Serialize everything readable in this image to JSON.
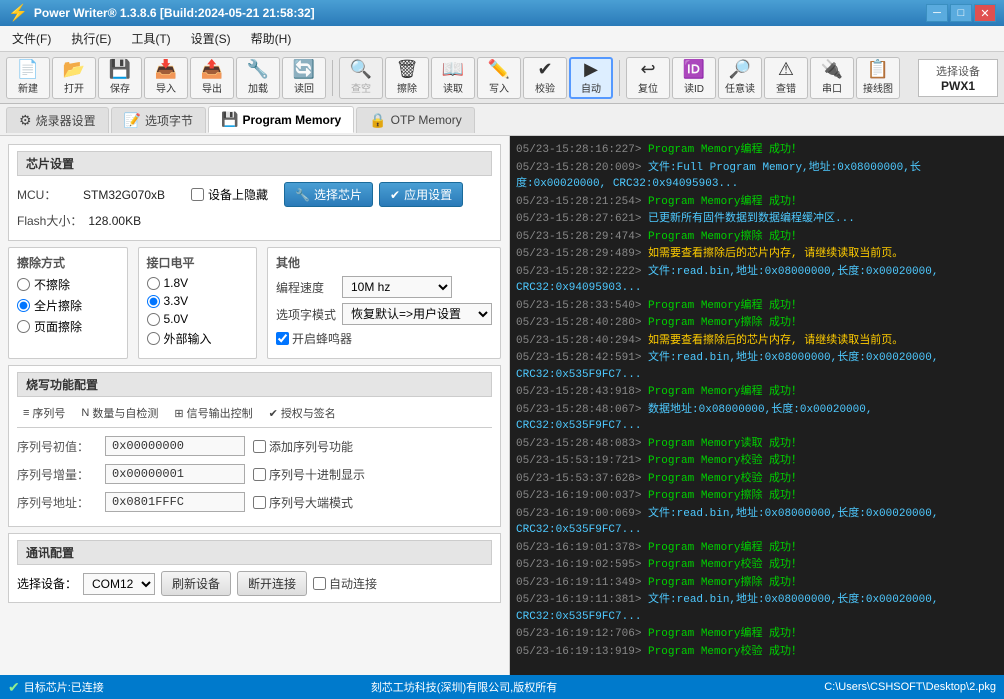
{
  "titlebar": {
    "title": "Power Writer® 1.3.8.6 [Build:2024-05-21 21:58:32]",
    "min": "─",
    "max": "□",
    "close": "✕"
  },
  "menubar": {
    "items": [
      "文件(F)",
      "执行(E)",
      "工具(T)",
      "设置(S)",
      "帮助(H)"
    ]
  },
  "toolbar": {
    "buttons": [
      {
        "label": "新建",
        "icon": "📄"
      },
      {
        "label": "打开",
        "icon": "📂"
      },
      {
        "label": "保存",
        "icon": "💾"
      },
      {
        "label": "导入",
        "icon": "📥"
      },
      {
        "label": "导出",
        "icon": "📤"
      },
      {
        "label": "加载",
        "icon": "🔧"
      },
      {
        "label": "读回",
        "icon": "🔄"
      },
      {
        "label": "查空",
        "icon": "🔍",
        "disabled": true
      },
      {
        "label": "擦除",
        "icon": "🗑"
      },
      {
        "label": "读取",
        "icon": "📖"
      },
      {
        "label": "写入",
        "icon": "✏️"
      },
      {
        "label": "校验",
        "icon": "✔"
      },
      {
        "label": "自动",
        "icon": "▶"
      },
      {
        "label": "复位",
        "icon": "↩"
      },
      {
        "label": "读ID",
        "icon": "🆔"
      },
      {
        "label": "任意读",
        "icon": "🔎"
      },
      {
        "label": "查错",
        "icon": "⚠"
      },
      {
        "label": "串口",
        "icon": "🔌"
      },
      {
        "label": "接线图",
        "icon": "📋"
      }
    ],
    "device_label": "选择设备",
    "device_value": "PWX1"
  },
  "tabs": [
    {
      "label": "烧录器设置",
      "icon": "⚙",
      "active": false
    },
    {
      "label": "选项字节",
      "icon": "📝",
      "active": false
    },
    {
      "label": "Program Memory",
      "icon": "💾",
      "active": true
    },
    {
      "label": "OTP Memory",
      "icon": "🔒",
      "active": false
    }
  ],
  "chip_settings": {
    "title": "芯片设置",
    "mcu_label": "MCU：",
    "mcu_value": "STM32G070xB",
    "hidden_label": "设备上隐藏",
    "flash_label": "Flash大小：",
    "flash_value": "128.00KB",
    "select_chip_btn": "选择芯片",
    "apply_btn": "应用设置"
  },
  "erase": {
    "title": "擦除方式",
    "options": [
      "不擦除",
      "全片擦除",
      "页面擦除"
    ],
    "selected": 1
  },
  "interface": {
    "title": "接口电平",
    "options": [
      "1.8V",
      "3.3V",
      "5.0V",
      "外部输入"
    ],
    "selected": 1
  },
  "other": {
    "title": "其他",
    "speed_label": "编程速度",
    "speed_value": "10M hz",
    "mode_label": "选项字模式",
    "mode_value": "恢复默认=>用户设置",
    "buzzer_label": "开启蜂鸣器",
    "buzzer_checked": true
  },
  "write_config": {
    "title": "烧写功能配置",
    "tabs": [
      {
        "icon": "≡",
        "label": "序列号"
      },
      {
        "icon": "N",
        "label": "数量与自检测"
      },
      {
        "icon": "⊞",
        "label": "信号输出控制"
      },
      {
        "icon": "✔",
        "label": "授权与签名"
      }
    ]
  },
  "serial_config": {
    "init_label": "序列号初值：",
    "init_value": "0x00000000",
    "add_label": "添加序列号功能",
    "inc_label": "序列号增量：",
    "inc_value": "0x00000001",
    "decimal_label": "序列号十进制显示",
    "addr_label": "序列号地址：",
    "addr_value": "0x0801FFFC",
    "bigendian_label": "序列号大端模式"
  },
  "comm": {
    "title": "通讯配置",
    "device_label": "选择设备：",
    "device_value": "COM12",
    "refresh_btn": "刷新设备",
    "disconnect_btn": "断开连接",
    "auto_label": "自动连接",
    "auto_checked": false
  },
  "log": {
    "lines": [
      {
        "time": "05/23-15:28:16:227>",
        "text": " Program Memory编程 成功！",
        "class": "log-success"
      },
      {
        "time": "05/23-15:28:20:009>",
        "text": " 文件:Full Program Memory,地址:0x08000000,长度:0x00020000, CRC32:0x94095903...",
        "class": "log-info"
      },
      {
        "time": "05/23-15:28:21:254>",
        "text": " Program Memory编程 成功！",
        "class": "log-success"
      },
      {
        "time": "05/23-15:28:27:621>",
        "text": " 已更新所有固件数据到数据编程缓冲区...",
        "class": "log-info"
      },
      {
        "time": "05/23-15:28:29:474>",
        "text": " Program Memory擦除 成功！",
        "class": "log-success"
      },
      {
        "time": "05/23-15:28:29:489>",
        "text": " 如需要查看擦除后的芯片内存, 请继续读取当前页。",
        "class": "log-warn"
      },
      {
        "time": "05/23-15:28:32:222>",
        "text": " 文件:read.bin,地址:0x08000000,长度:0x00020000, CRC32:0x94095903...",
        "class": "log-info"
      },
      {
        "time": "05/23-15:28:33:540>",
        "text": " Program Memory编程 成功！",
        "class": "log-success"
      },
      {
        "time": "05/23-15:28:40:280>",
        "text": " Program Memory擦除 成功！",
        "class": "log-success"
      },
      {
        "time": "05/23-15:28:40:294>",
        "text": " 如需要查看擦除后的芯片内存, 请继续读取当前页。",
        "class": "log-warn"
      },
      {
        "time": "05/23-15:28:42:591>",
        "text": " 文件:read.bin,地址:0x08000000,长度:0x00020000, CRC32:0x535F9FC7...",
        "class": "log-info"
      },
      {
        "time": "05/23-15:28:43:918>",
        "text": " Program Memory编程 成功！",
        "class": "log-success"
      },
      {
        "time": "05/23-15:28:48:067>",
        "text": " 数据地址:0x08000000,长度:0x00020000, CRC32:0x535F9FC7...",
        "class": "log-info"
      },
      {
        "time": "05/23-15:28:48:083>",
        "text": " Program Memory读取 成功！",
        "class": "log-success"
      },
      {
        "time": "05/23-15:53:19:721>",
        "text": " Program Memory校验 成功！",
        "class": "log-success"
      },
      {
        "time": "05/23-15:53:37:628>",
        "text": " Program Memory校验 成功！",
        "class": "log-success"
      },
      {
        "time": "05/23-16:19:00:037>",
        "text": " Program Memory擦除 成功！",
        "class": "log-success"
      },
      {
        "time": "05/23-16:19:00:069>",
        "text": " 文件:read.bin,地址:0x08000000,长度:0x00020000, CRC32:0x535F9FC7...",
        "class": "log-info"
      },
      {
        "time": "05/23-16:19:01:378>",
        "text": " Program Memory编程 成功！",
        "class": "log-success"
      },
      {
        "time": "05/23-16:19:02:595>",
        "text": " Program Memory校验 成功！",
        "class": "log-success"
      },
      {
        "time": "05/23-16:19:11:349>",
        "text": " Program Memory擦除 成功！",
        "class": "log-success"
      },
      {
        "time": "05/23-16:19:11:381>",
        "text": " 文件:read.bin,地址:0x08000000,长度:0x00020000, CRC32:0x535F9FC7...",
        "class": "log-info"
      },
      {
        "time": "05/23-16:19:12:706>",
        "text": " Program Memory编程 成功！",
        "class": "log-success"
      },
      {
        "time": "05/23-16:19:13:919>",
        "text": " Program Memory校验 成功！",
        "class": "log-success"
      }
    ]
  },
  "statusbar": {
    "left": "目标芯片:已连接",
    "center": "刻芯工坊科技(深圳)有限公司,版权所有",
    "right": "C:\\Users\\CSHSOFT\\Desktop\\2.pkg"
  }
}
